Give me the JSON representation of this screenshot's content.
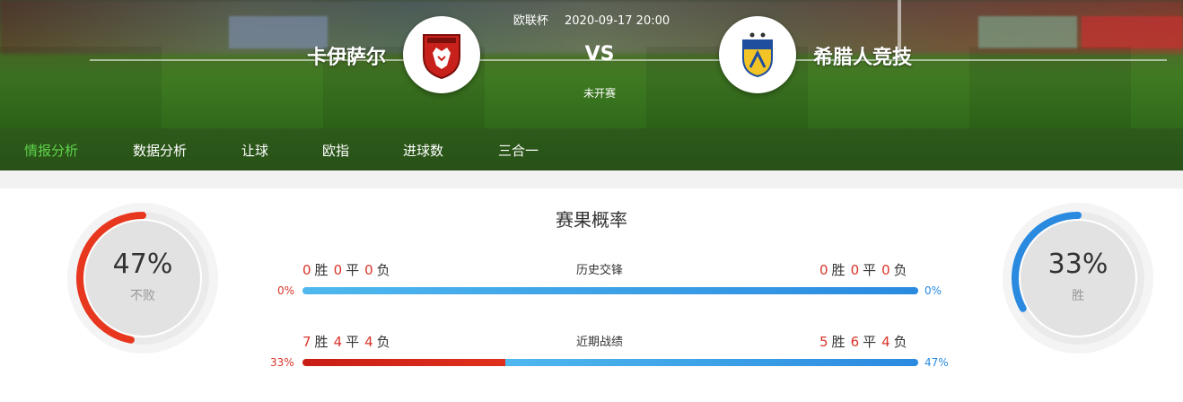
{
  "match": {
    "competition": "欧联杯",
    "datetime": "2020-09-17 20:00",
    "vs": "VS",
    "status": "未开赛",
    "home": {
      "name": "卡伊萨尔",
      "badge_icon": "kaisar-badge-icon"
    },
    "away": {
      "name": "希腊人竞技",
      "badge_icon": "apoel-badge-icon"
    }
  },
  "tabs": [
    {
      "label": "情报分析",
      "active": true
    },
    {
      "label": "数据分析",
      "active": false
    },
    {
      "label": "让球",
      "active": false
    },
    {
      "label": "欧指",
      "active": false
    },
    {
      "label": "进球数",
      "active": false
    },
    {
      "label": "三合一",
      "active": false
    }
  ],
  "section_title": "赛果概率",
  "home_ring": {
    "percent": "47%",
    "value": 0.47,
    "label": "不败",
    "color": "#e8371f"
  },
  "away_ring": {
    "percent": "33%",
    "value": 0.33,
    "label": "胜",
    "color": "#2a8ae0"
  },
  "rows": [
    {
      "title": "历史交锋",
      "home": {
        "w": "0",
        "d": "0",
        "l": "0"
      },
      "away": {
        "w": "0",
        "d": "0",
        "l": "0"
      },
      "home_pct": "0%",
      "away_pct": "0%",
      "home_share": 0.0
    },
    {
      "title": "近期战绩",
      "home": {
        "w": "7",
        "d": "4",
        "l": "4"
      },
      "away": {
        "w": "5",
        "d": "6",
        "l": "4"
      },
      "home_pct": "33%",
      "away_pct": "47%",
      "home_share": 0.33
    }
  ],
  "labels": {
    "win": "胜",
    "draw": "平",
    "loss": "负"
  },
  "colors": {
    "home_bar": "#e0301e",
    "away_bar": "#2a8ae0",
    "tab_active": "#5fd24a"
  }
}
